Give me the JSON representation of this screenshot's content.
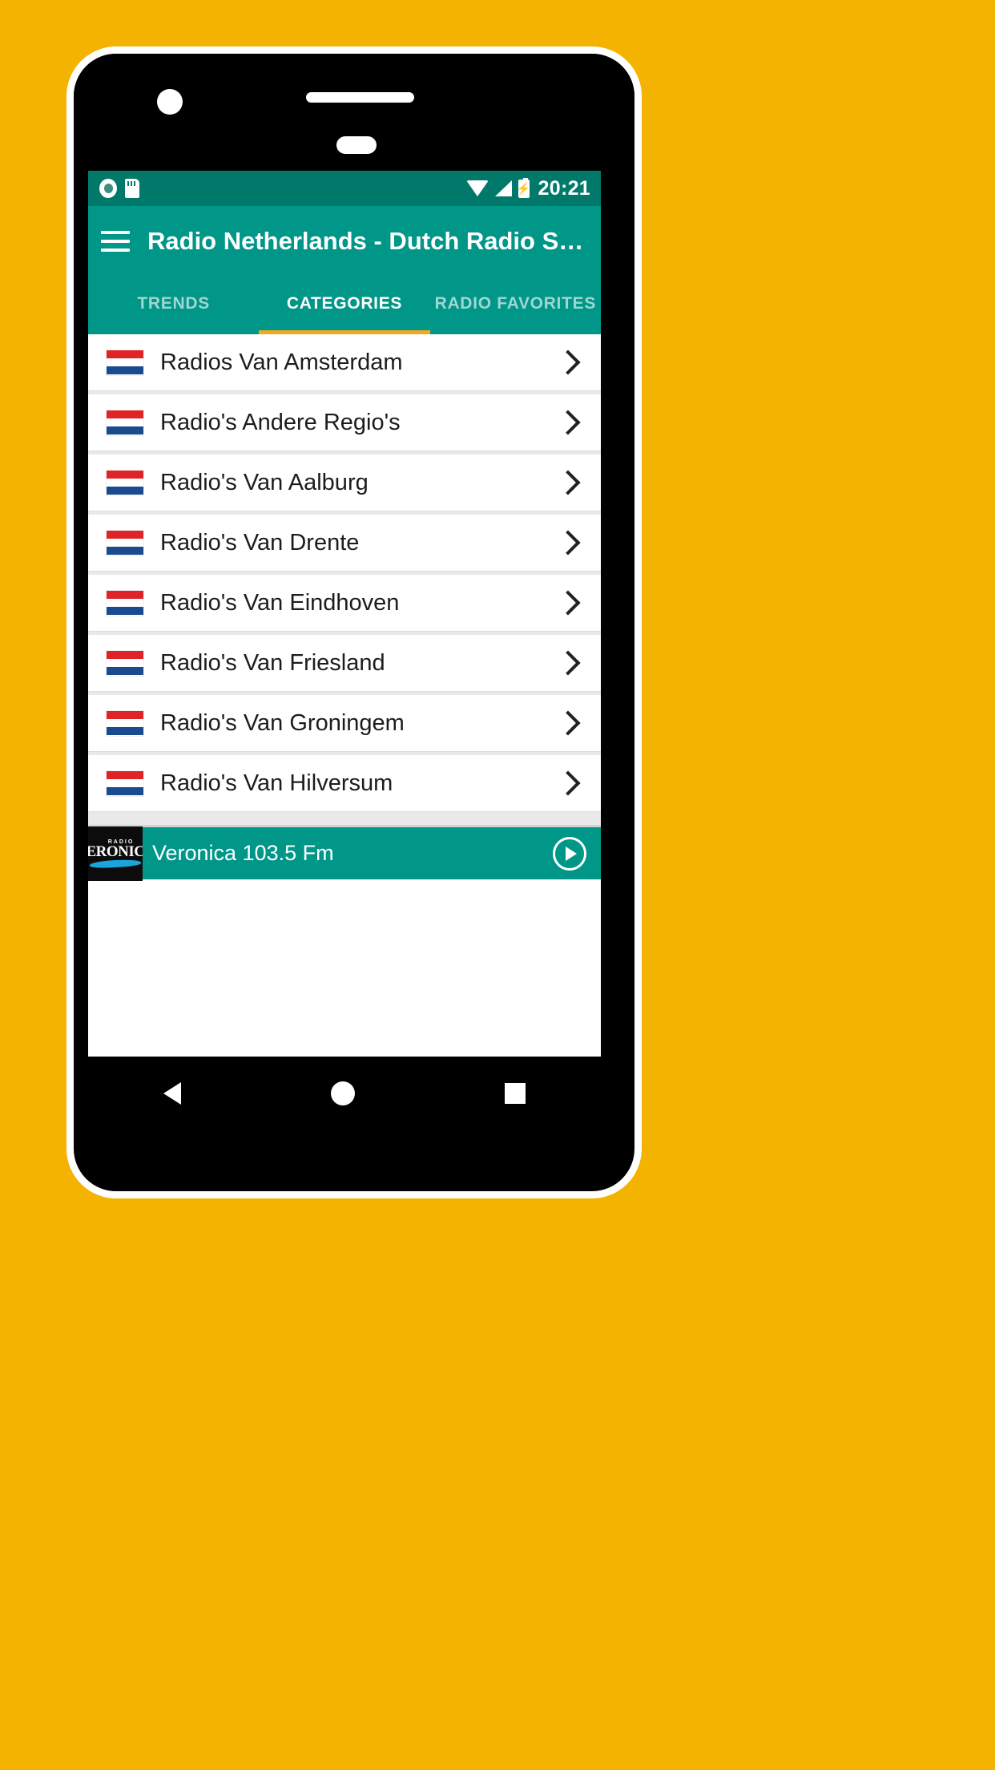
{
  "status_bar": {
    "time": "20:21",
    "icons": [
      "record-icon",
      "sd-card-icon",
      "wifi-icon",
      "signal-icon",
      "battery-charging-icon"
    ]
  },
  "app_bar": {
    "menu_icon": "hamburger-menu-icon",
    "title": "Radio Netherlands - Dutch Radio Stat..."
  },
  "tabs": [
    {
      "label": "TRENDS",
      "active": false
    },
    {
      "label": "CATEGORIES",
      "active": true
    },
    {
      "label": "RADIO FAVORITES",
      "active": false
    }
  ],
  "categories": [
    {
      "label": "Radios Van Amsterdam"
    },
    {
      "label": "Radio's Andere Regio's"
    },
    {
      "label": "Radio's Van Aalburg"
    },
    {
      "label": "Radio's Van Drente"
    },
    {
      "label": "Radio's Van Eindhoven"
    },
    {
      "label": "Radio's Van Friesland"
    },
    {
      "label": "Radio's Van Groningem"
    },
    {
      "label": "Radio's Van Hilversum"
    }
  ],
  "player": {
    "logo_top": "RADIO",
    "logo_name": "VERONICA",
    "station": "Veronica 103.5 Fm",
    "play_icon": "play-icon"
  },
  "nav_bar": {
    "back": "back-icon",
    "home": "home-icon",
    "recents": "recents-icon"
  },
  "colors": {
    "background": "#F5B301",
    "primary": "#009688",
    "primary_dark": "#00796B",
    "accent": "#F5A623",
    "flag_red": "#E02327",
    "flag_blue": "#1B4B8F"
  }
}
